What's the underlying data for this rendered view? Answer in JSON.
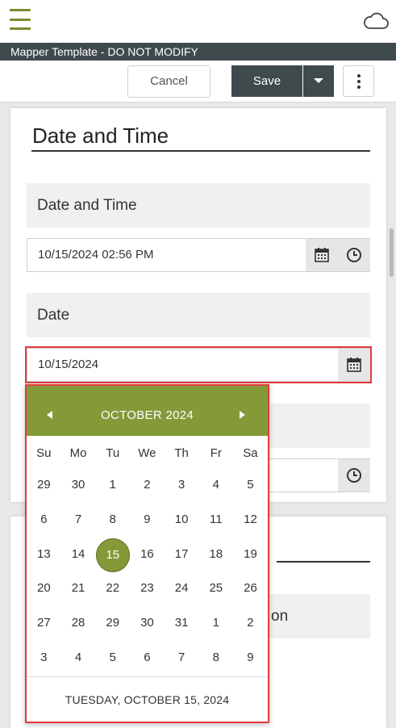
{
  "header": {
    "app_title": "Mapper Template - DO NOT MODIFY"
  },
  "toolbar": {
    "cancel_label": "Cancel",
    "save_label": "Save"
  },
  "section": {
    "title": "Date and Time",
    "fields": [
      {
        "label": "Date and Time",
        "value": "10/15/2024 02:56 PM"
      },
      {
        "label": "Date",
        "value": "10/15/2024"
      }
    ]
  },
  "card2": {
    "label_fragment": "on"
  },
  "calendar": {
    "month_label": "OCTOBER 2024",
    "weekdays": [
      "Su",
      "Mo",
      "Tu",
      "We",
      "Th",
      "Fr",
      "Sa"
    ],
    "days": [
      "29",
      "30",
      "1",
      "2",
      "3",
      "4",
      "5",
      "6",
      "7",
      "8",
      "9",
      "10",
      "11",
      "12",
      "13",
      "14",
      "15",
      "16",
      "17",
      "18",
      "19",
      "20",
      "21",
      "22",
      "23",
      "24",
      "25",
      "26",
      "27",
      "28",
      "29",
      "30",
      "31",
      "1",
      "2",
      "3",
      "4",
      "5",
      "6",
      "7",
      "8",
      "9"
    ],
    "selected_day": "15",
    "footer": "TUESDAY, OCTOBER 15, 2024"
  },
  "colors": {
    "accent": "#849938",
    "dark": "#3f4a4d",
    "highlight": "#e23b3b"
  }
}
